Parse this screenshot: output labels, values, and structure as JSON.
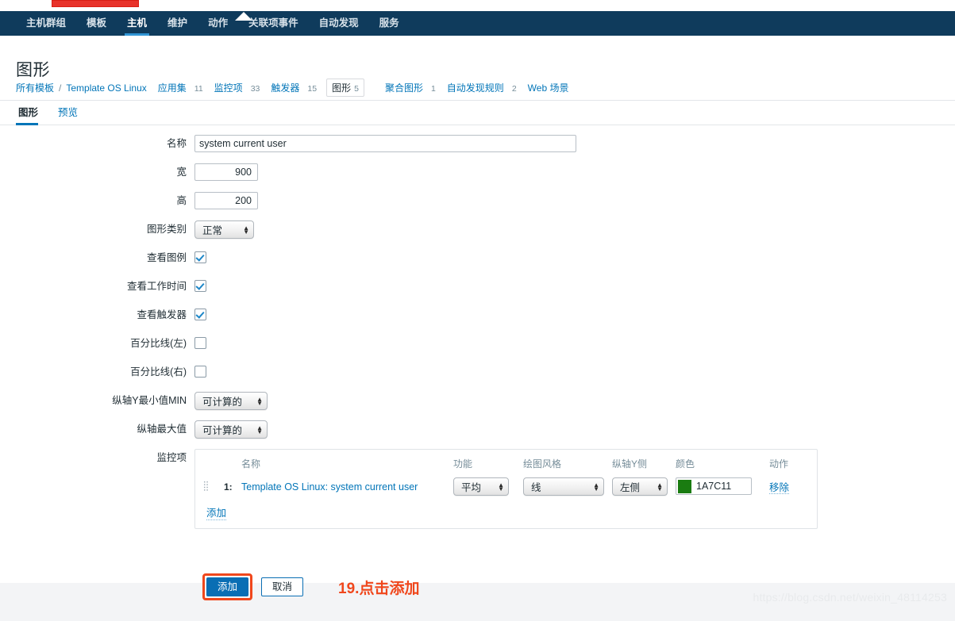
{
  "topbar": {
    "red_marker_label": ""
  },
  "nav": {
    "items": [
      {
        "label": "主机群组",
        "active": false
      },
      {
        "label": "模板",
        "active": false
      },
      {
        "label": "主机",
        "active": true
      },
      {
        "label": "维护",
        "active": false
      },
      {
        "label": "动作",
        "active": false
      },
      {
        "label": "关联项事件",
        "active": false
      },
      {
        "label": "自动发现",
        "active": false
      },
      {
        "label": "服务",
        "active": false
      }
    ]
  },
  "page": {
    "title": "图形"
  },
  "breadcrumb": {
    "root": "所有模板",
    "separator": "/",
    "template": "Template OS Linux",
    "entries": [
      {
        "label": "应用集",
        "count": "11",
        "selected": false
      },
      {
        "label": "监控项",
        "count": "33",
        "selected": false
      },
      {
        "label": "触发器",
        "count": "15",
        "selected": false
      },
      {
        "label": "图形",
        "count": "5",
        "selected": true
      },
      {
        "label": "聚合图形",
        "count": "1",
        "selected": false
      },
      {
        "label": "自动发现规则",
        "count": "2",
        "selected": false
      },
      {
        "label": "Web 场景",
        "count": "",
        "selected": false
      }
    ]
  },
  "subtabs": [
    {
      "label": "图形",
      "active": true
    },
    {
      "label": "预览",
      "active": false
    }
  ],
  "form": {
    "name_label": "名称",
    "name_value": "system current user",
    "width_label": "宽",
    "width_value": "900",
    "height_label": "高",
    "height_value": "200",
    "graph_type_label": "图形类别",
    "graph_type_value": "正常",
    "show_legend_label": "查看图例",
    "show_legend_checked": true,
    "show_worktime_label": "查看工作时间",
    "show_worktime_checked": true,
    "show_triggers_label": "查看触发器",
    "show_triggers_checked": true,
    "percentile_left_label": "百分比线(左)",
    "percentile_left_checked": false,
    "percentile_right_label": "百分比线(右)",
    "percentile_right_checked": false,
    "ymin_label": "纵轴Y最小值MIN",
    "ymin_value": "可计算的",
    "ymax_label": "纵轴最大值",
    "ymax_value": "可计算的",
    "items_label": "监控项"
  },
  "items_table": {
    "headers": {
      "name": "名称",
      "function": "功能",
      "draw_style": "绘图风格",
      "y_axis": "纵轴Y侧",
      "color": "颜色",
      "action": "动作"
    },
    "rows": [
      {
        "index": "1:",
        "name": "Template OS Linux: system current user",
        "function": "平均",
        "draw_style": "线",
        "y_axis": "左侧",
        "color_hex": "1A7C11",
        "color_value": "#1A7C11",
        "action": "移除"
      }
    ],
    "add_link": "添加"
  },
  "footer": {
    "submit_label": "添加",
    "cancel_label": "取消",
    "annotation": "19.点击添加",
    "highlight_color": "#f0471c"
  },
  "watermark": "https://blog.csdn.net/weixin_48114253",
  "colors": {
    "nav_bg": "#0f3b5c",
    "accent_blue": "#0275b8",
    "primary_button": "#0a6eb4",
    "series_green": "#1A7C11",
    "annotation_red": "#f0471c"
  }
}
